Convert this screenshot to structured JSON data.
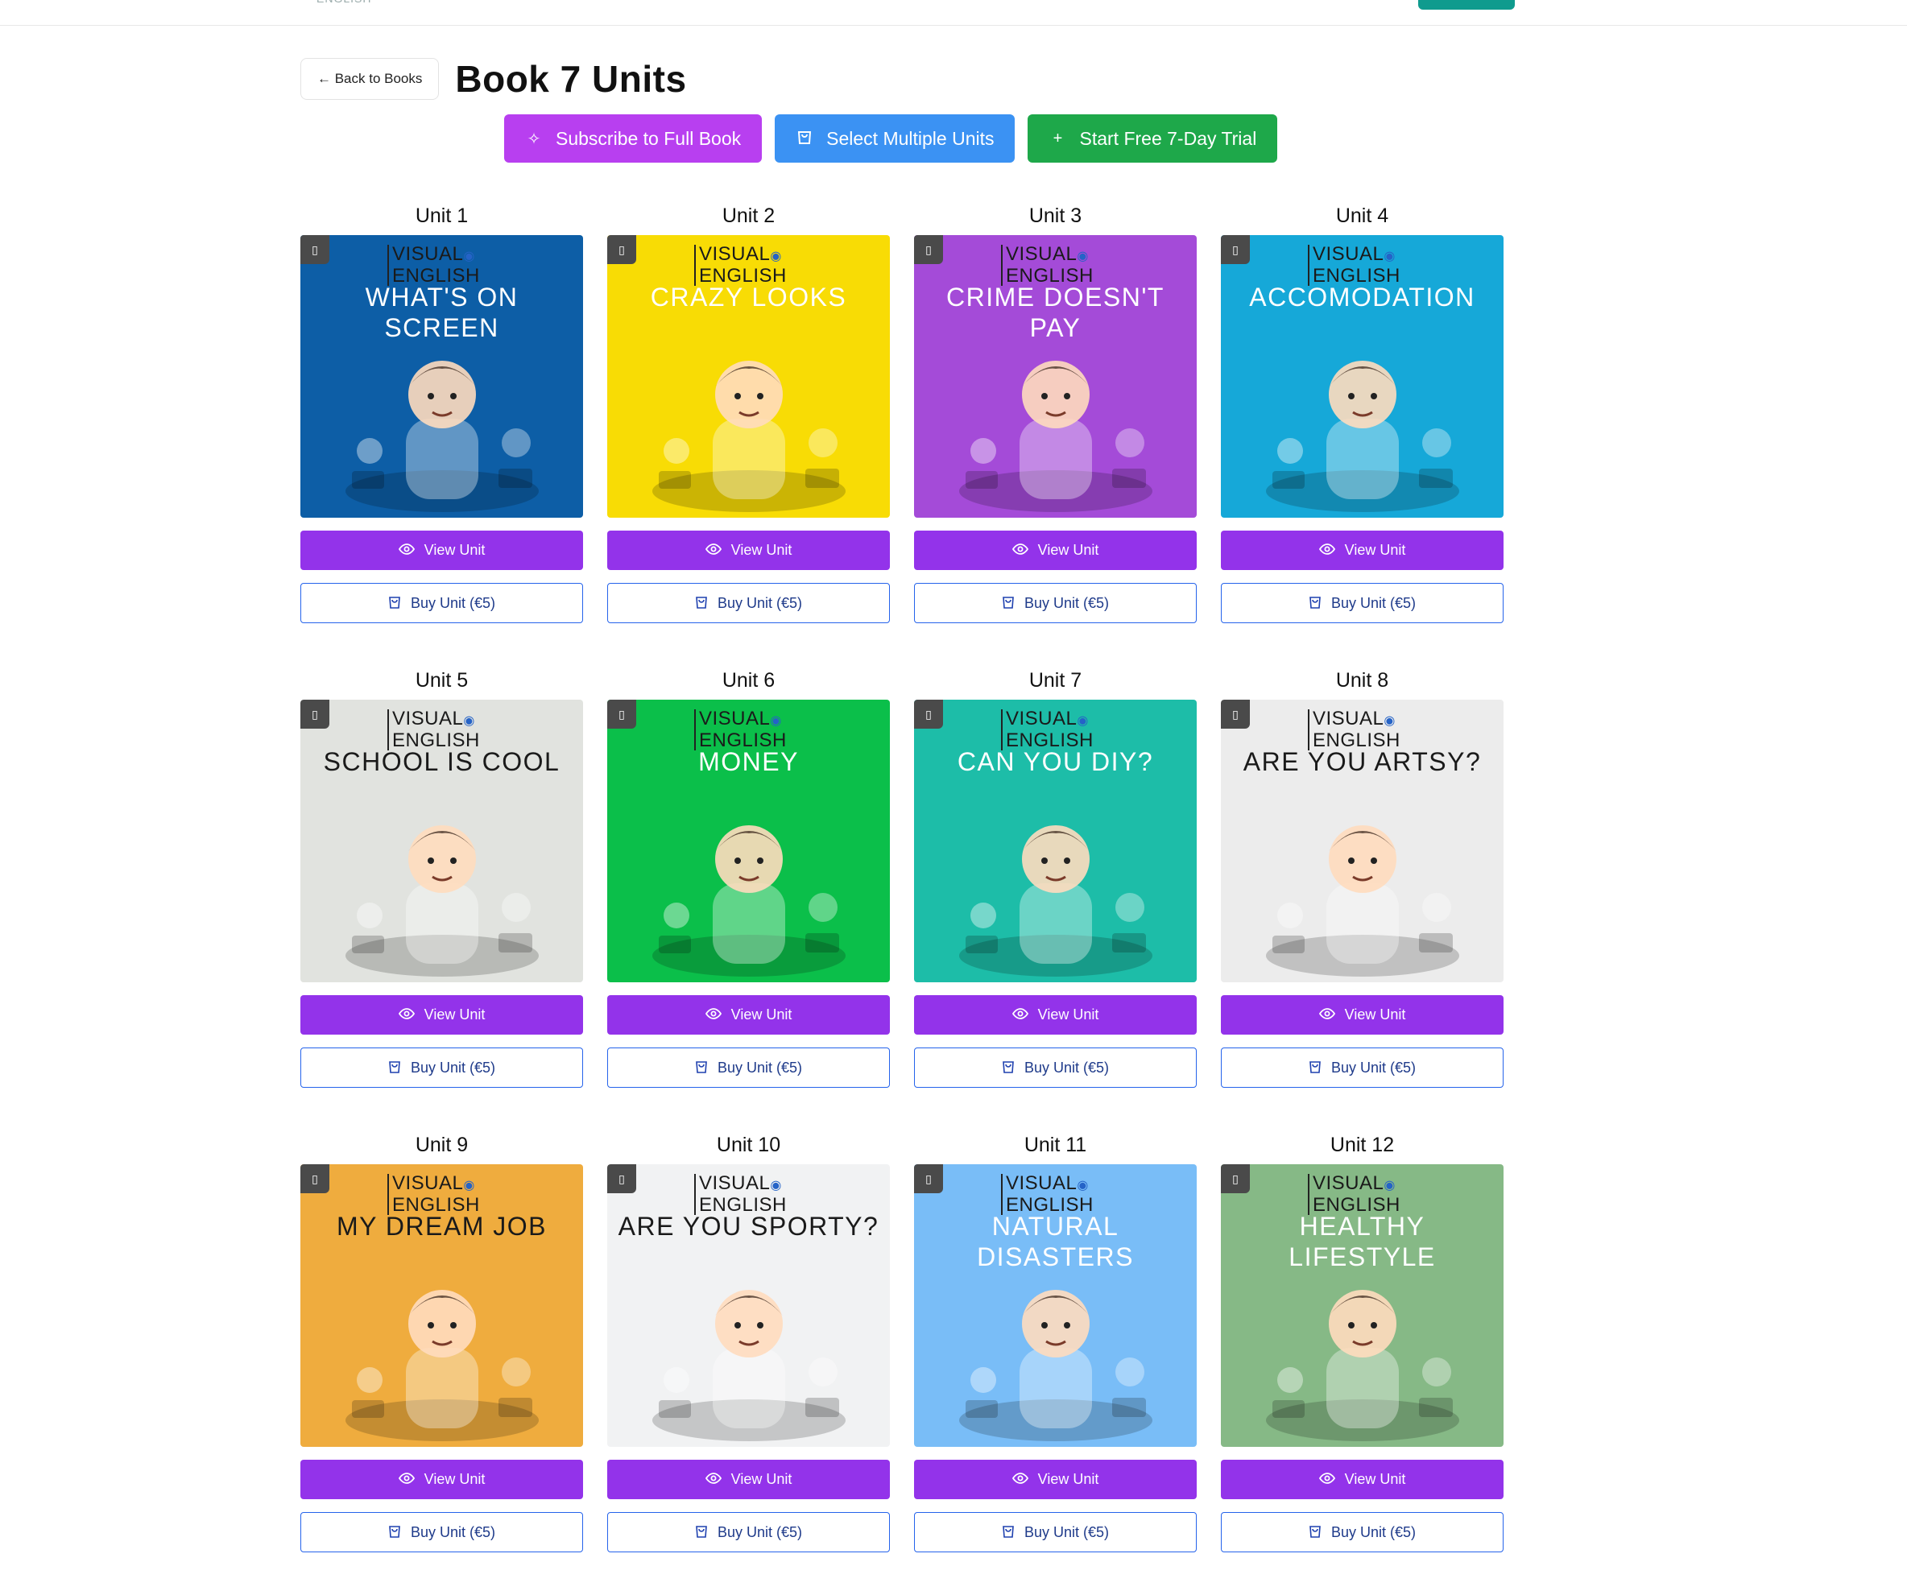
{
  "header": {
    "back_label": "← Back to Books",
    "title": "Book 7 Units"
  },
  "actions": {
    "subscribe_label": "Subscribe to Full Book",
    "select_label": "Select Multiple Units",
    "trial_label": "Start Free 7-Day Trial"
  },
  "brand": {
    "line1": "VISUAL",
    "line2": "ENGLISH"
  },
  "buttons": {
    "view_label": "View Unit",
    "buy_label": "Buy Unit (€5)"
  },
  "units": [
    {
      "label": "Unit 1",
      "cover_title": "WHAT'S ON SCREEN",
      "bg": "#0d5ea6",
      "text": "light"
    },
    {
      "label": "Unit 2",
      "cover_title": "CRAZY LOOKS",
      "bg": "#f8dc05",
      "text": "light"
    },
    {
      "label": "Unit 3",
      "cover_title": "CRIME DOESN'T PAY",
      "bg": "#a44bd8",
      "text": "light"
    },
    {
      "label": "Unit 4",
      "cover_title": "ACCOMODATION",
      "bg": "#16a8d8",
      "text": "light"
    },
    {
      "label": "Unit 5",
      "cover_title": "SCHOOL IS COOL",
      "bg": "#e1e3df",
      "text": "dark"
    },
    {
      "label": "Unit 6",
      "cover_title": "MONEY",
      "bg": "#0bbf4a",
      "text": "light"
    },
    {
      "label": "Unit 7",
      "cover_title": "CAN YOU DIY?",
      "bg": "#1dbda8",
      "text": "light"
    },
    {
      "label": "Unit 8",
      "cover_title": "ARE YOU ARTSY?",
      "bg": "#ececec",
      "text": "dark"
    },
    {
      "label": "Unit 9",
      "cover_title": "MY DREAM JOB",
      "bg": "#efac3e",
      "text": "dark"
    },
    {
      "label": "Unit 10",
      "cover_title": "ARE YOU SPORTY?",
      "bg": "#f1f2f3",
      "text": "dark"
    },
    {
      "label": "Unit 11",
      "cover_title": "NATURAL DISASTERS",
      "bg": "#79bdf7",
      "text": "light"
    },
    {
      "label": "Unit 12",
      "cover_title": "HEALTHY LIFESTYLE",
      "bg": "#86b986",
      "text": "light"
    }
  ]
}
